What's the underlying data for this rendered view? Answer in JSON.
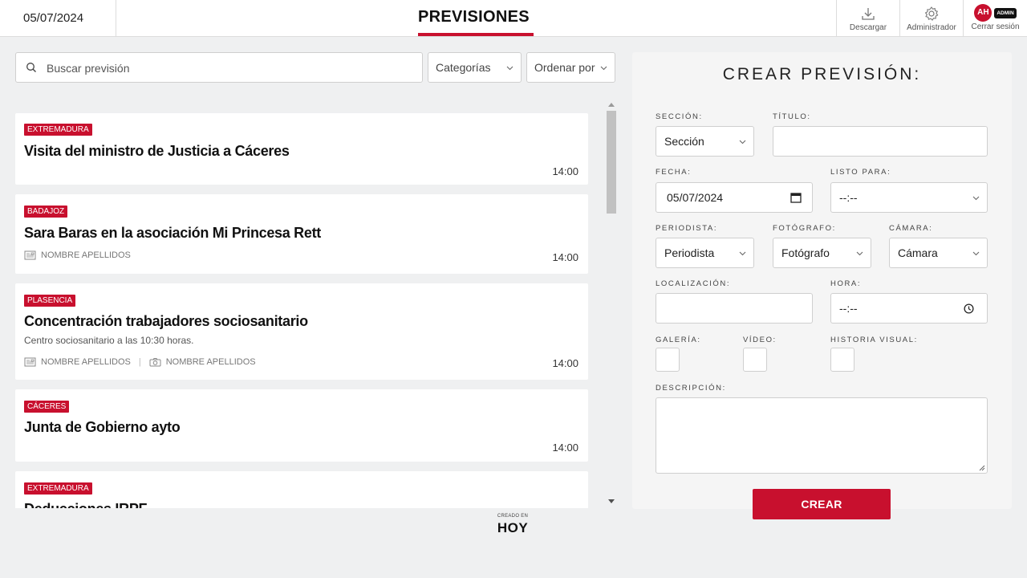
{
  "header": {
    "date": "05/07/2024",
    "title": "PREVISIONES",
    "download_label": "Descargar",
    "admin_label": "Administrador",
    "logout_label": "Cerrar sesión",
    "avatar_initials": "AH",
    "admin_badge": "ADMIN"
  },
  "toolbar": {
    "search_placeholder": "Buscar previsión",
    "categories_label": "Categorías",
    "sort_label": "Ordenar por"
  },
  "previsiones": [
    {
      "tag": "EXTREMADURA",
      "title": "Visita del ministro de Justicia a Cáceres",
      "time": "14:00"
    },
    {
      "tag": "BADAJOZ",
      "title": "Sara Baras en la asociación Mi Princesa Rett",
      "journalist": "NOMBRE APELLIDOS",
      "time": "14:00"
    },
    {
      "tag": "PLASENCIA",
      "title": "Concentración trabajadores sociosanitario",
      "description": "Centro sociosanitario a las 10:30 horas.",
      "journalist": "NOMBRE APELLIDOS",
      "photographer": "NOMBRE APELLIDOS",
      "time": "14:00"
    },
    {
      "tag": "CÁCERES",
      "title": "Junta de Gobierno ayto",
      "time": "14:00"
    },
    {
      "tag": "EXTREMADURA",
      "title": "Deducciones IRPF"
    }
  ],
  "footer": {
    "created_in": "CREADO EN",
    "logo": "HOY"
  },
  "form": {
    "title": "CREAR PREVISIÓN:",
    "seccion_label": "SECCIÓN:",
    "seccion_value": "Sección",
    "titulo_label": "TÍTULO:",
    "fecha_label": "FECHA:",
    "fecha_value": "05/07/2024",
    "listo_label": "LISTO PARA:",
    "listo_value": "--:--",
    "periodista_label": "PERIODISTA:",
    "periodista_value": "Periodista",
    "fotografo_label": "FOTÓGRAFO:",
    "fotografo_value": "Fotógrafo",
    "camara_label": "CÁMARA:",
    "camara_value": "Cámara",
    "localizacion_label": "LOCALIZACIÓN:",
    "hora_label": "HORA:",
    "hora_value": "--:--",
    "galeria_label": "GALERÍA:",
    "video_label": "VÍDEO:",
    "historia_label": "HISTORIA VISUAL:",
    "descripcion_label": "DESCRIPCIÓN:",
    "submit_label": "CREAR"
  },
  "colors": {
    "accent": "#c8102e"
  }
}
